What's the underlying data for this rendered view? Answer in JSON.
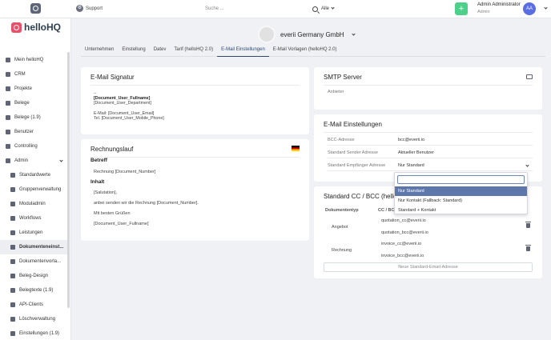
{
  "topbar": {
    "support_label": "Support",
    "search_placeholder": "Suche ...",
    "search_filter": "Alle",
    "user_name": "Admin Administrator",
    "user_role": "Admin",
    "avatar_initials": "AA"
  },
  "brand": {
    "name": "helloHQ"
  },
  "sidebar": {
    "items": [
      {
        "label": "Mein helloHQ"
      },
      {
        "label": "CRM"
      },
      {
        "label": "Projekte"
      },
      {
        "label": "Belege"
      },
      {
        "label": "Belege (1.9)"
      },
      {
        "label": "Benutzer"
      },
      {
        "label": "Controlling"
      },
      {
        "label": "Admin"
      },
      {
        "label": "Standardwerte"
      },
      {
        "label": "Gruppenverwaltung"
      },
      {
        "label": "Moduladmin"
      },
      {
        "label": "Workflows"
      },
      {
        "label": "Leistungen"
      },
      {
        "label": "Dokumenteneinst..."
      },
      {
        "label": "Dokumentenvorla..."
      },
      {
        "label": "Beleg-Design"
      },
      {
        "label": "Belegtexte (1.9)"
      },
      {
        "label": "API-Clients"
      },
      {
        "label": "Löschverwaltung"
      },
      {
        "label": "Einstellungen (1.9)"
      }
    ]
  },
  "company": {
    "name": "everii Germany GmbH"
  },
  "tabs": [
    {
      "label": "Unternehmen"
    },
    {
      "label": "Einstellung"
    },
    {
      "label": "Datev"
    },
    {
      "label": "Tarif (helloHQ 2.0)"
    },
    {
      "label": "E-Mail Einstellungen"
    },
    {
      "label": "E-Mail Vorlagen (helloHQ 2.0)"
    }
  ],
  "signature": {
    "title": "E-Mail Signatur",
    "dashes": "--",
    "fullname": "[Document_User_Fullname]",
    "department": "[Document_User_Department]",
    "email": "E-Mail: [Document_User_Email]",
    "phone": "Tel. [Document_User_Mobile_Phone]"
  },
  "rechnungslauf": {
    "title": "Rechnungslauf",
    "betreff_heading": "Betreff",
    "betreff_text": "Rechnung [Document_Number]",
    "inhalt_heading": "Inhalt",
    "salutation": "[Salutation],",
    "body": "anbei senden wir die Rechnung [Document_Number].",
    "greeting": "Mit besten Grüßen",
    "signoff": "[Document_User_Fullname]"
  },
  "smtp": {
    "title": "SMTP Server",
    "label": "Anbieter"
  },
  "email_settings": {
    "title": "E-Mail Einstellungen",
    "rows": [
      {
        "label": "BCC-Adresse",
        "value": "bcc@everii.io"
      },
      {
        "label": "Standard Sender Adresse",
        "value": "Aktueller Benutzer"
      },
      {
        "label": "Standard Empfänger Adresse",
        "value": "Nur Standard"
      }
    ]
  },
  "dropdown": {
    "options": [
      {
        "label": "Nur Standard",
        "selected": true
      },
      {
        "label": "Nur Kontakt (Fallback: Standard)"
      },
      {
        "label": "Standard + Kontakt"
      }
    ]
  },
  "cc_bcc": {
    "title": "Standard CC / BCC (hello",
    "col_type": "Dokumententyp",
    "col_addr": "CC / BC",
    "rows": [
      {
        "type": "Angebot",
        "cc": "quotation_cc@everii.io",
        "bcc": "quotation_bcc@everii.io"
      },
      {
        "type": "Rechnung",
        "cc": "invoice_cc@everii.io",
        "bcc": "invoice_bcc@everii.io"
      }
    ],
    "new_button": "Neue Standard-Email-Adresse"
  }
}
